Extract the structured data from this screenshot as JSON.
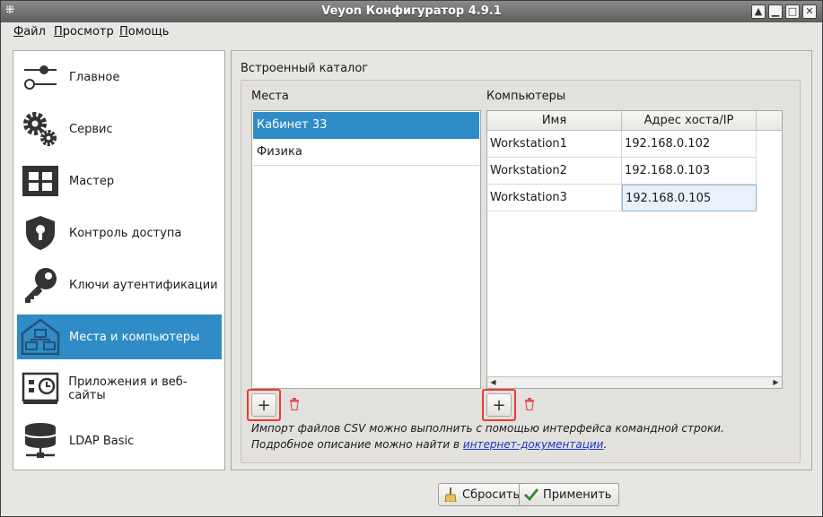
{
  "window": {
    "title": "Veyon Конфигуратор 4.9.1"
  },
  "menubar": [
    {
      "label": "Файл"
    },
    {
      "label": "Просмотр"
    },
    {
      "label": "Помощь"
    }
  ],
  "sidebar": {
    "items": [
      {
        "label": "Главное",
        "icon": "sliders-icon"
      },
      {
        "label": "Сервис",
        "icon": "gears-icon"
      },
      {
        "label": "Мастер",
        "icon": "grid-icon"
      },
      {
        "label": "Контроль доступа",
        "icon": "shield-lock-icon"
      },
      {
        "label": "Ключи аутентификации",
        "icon": "key-icon"
      },
      {
        "label": "Места и компьютеры",
        "icon": "network-house-icon",
        "active": true
      },
      {
        "label": "Приложения и веб-сайты",
        "icon": "apps-clock-icon"
      },
      {
        "label": "LDAP Basic",
        "icon": "database-network-icon"
      }
    ]
  },
  "content": {
    "group_title": "Встроенный каталог",
    "locations": {
      "label": "Места",
      "items": [
        "Кабинет 33",
        "Физика"
      ],
      "selected_index": 0
    },
    "computers": {
      "label": "Компьютеры",
      "columns": [
        "Имя",
        "Адрес хоста/IP"
      ],
      "rows": [
        [
          "Workstation1",
          "192.168.0.102"
        ],
        [
          "Workstation2",
          "192.168.0.103"
        ],
        [
          "Workstation3",
          "192.168.0.105"
        ]
      ]
    },
    "note": {
      "text": "Импорт файлов CSV можно выполнить с помощью интерфейса командной строки. Подробное описание можно найти в ",
      "link": "интернет-документации",
      "suffix": "."
    }
  },
  "buttons": {
    "reset": "Сбросить",
    "apply": "Применить"
  },
  "colors": {
    "accent": "#308cc6",
    "highlight": "#ec3b2a",
    "link": "#1a39c4",
    "delete_icon": "#e05050"
  }
}
